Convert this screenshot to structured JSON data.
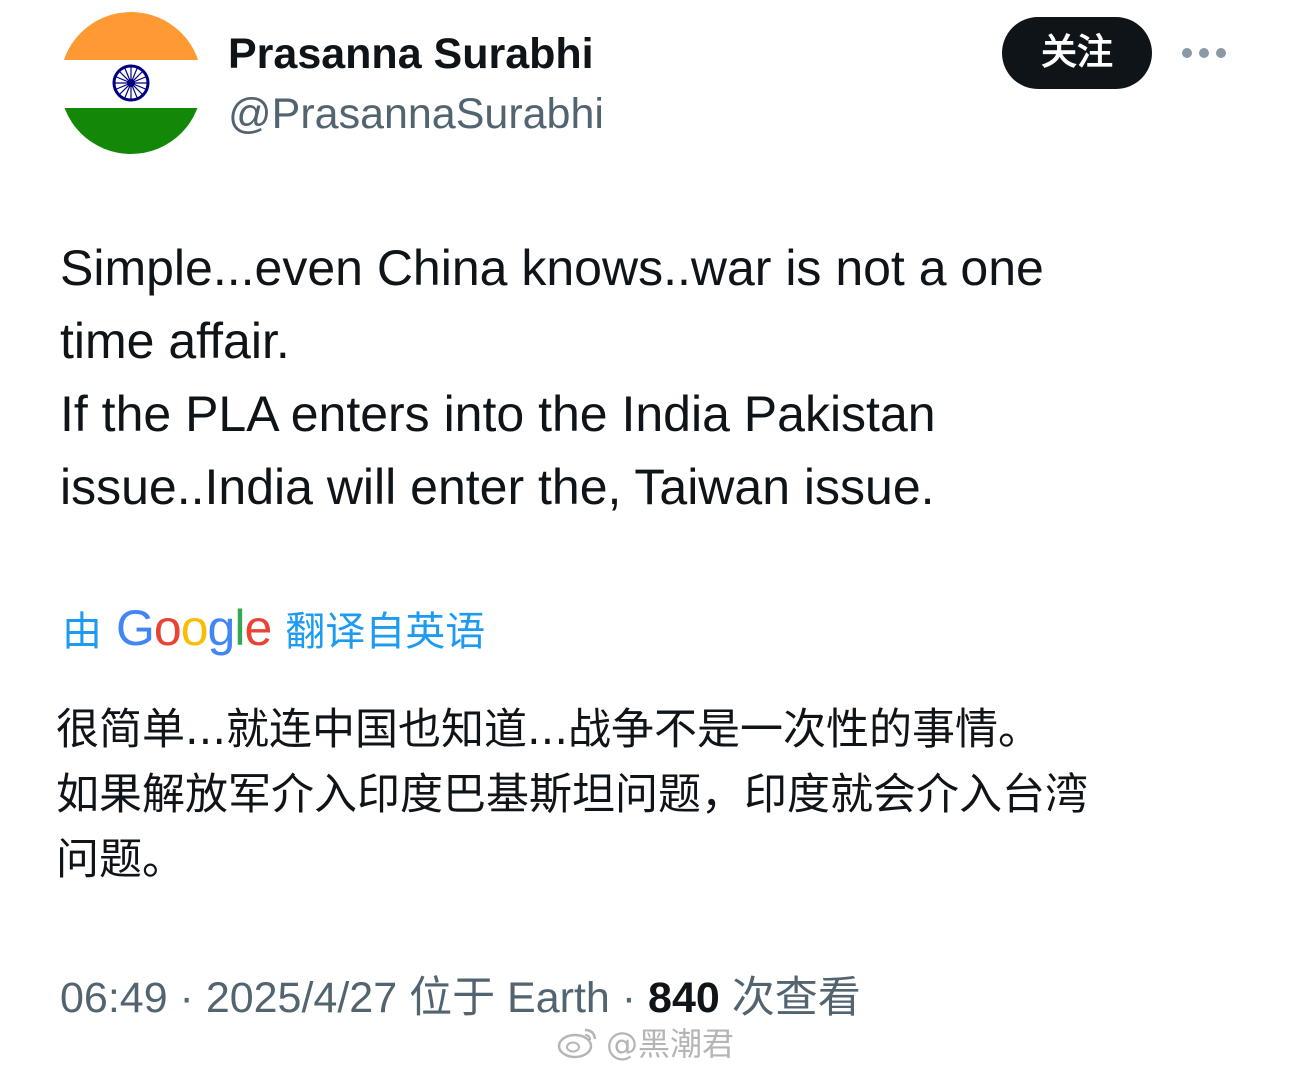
{
  "author": {
    "display_name": "Prasanna Surabhi",
    "handle": "@PrasannaSurabhi",
    "avatar_icon": "india-flag-icon",
    "avatar_colors": {
      "saffron": "#ff9933",
      "white": "#ffffff",
      "green": "#138808",
      "chakra": "#000080"
    }
  },
  "actions": {
    "follow_label": "关注",
    "more_icon": "more-dots-icon"
  },
  "tweet": {
    "lines": [
      "Simple...even China knows..war is not a one",
      "time affair.",
      "If the PLA enters into the India Pakistan",
      "issue..India will enter the, Taiwan issue."
    ]
  },
  "translation": {
    "prefix": "由",
    "provider": "Google",
    "suffix": "翻译自英语",
    "link_color": "#1d9bf0",
    "lines": [
      "很简单...就连中国也知道...战争不是一次性的事情。",
      "如果解放军介入印度巴基斯坦问题，印度就会介入台湾",
      "问题。"
    ]
  },
  "meta": {
    "time_date": "06:49 · 2025/4/27",
    "location": "位于 Earth",
    "separator": "·",
    "views_count": "840",
    "views_label": "次查看"
  },
  "watermark": {
    "icon": "weibo-icon",
    "text": "@黑潮君"
  }
}
